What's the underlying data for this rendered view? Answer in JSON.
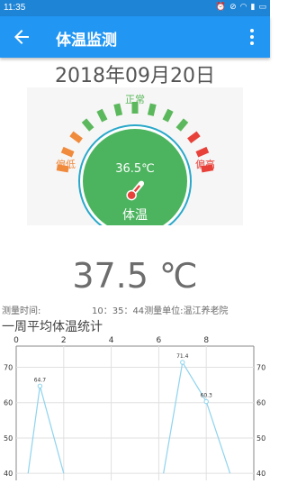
{
  "status": {
    "time": "11:35"
  },
  "appbar": {
    "title": "体温监测",
    "back_icon": "arrow-back-icon",
    "more_icon": "more-vert-icon"
  },
  "date": "2018年09月20日",
  "gauge": {
    "label_normal": "正常",
    "label_low": "偏低",
    "label_high": "偏高",
    "center_temp": "36.5℃",
    "center_label": "体温",
    "icon": "thermometer-icon",
    "colors": {
      "low": "#f08a3c",
      "normal": "#5cb85c",
      "high": "#e8413a",
      "center": "#4cb45f",
      "ring": "#2aa8c9"
    }
  },
  "current_temp": "37.5 ℃",
  "measure": {
    "time_label": "测量时间:",
    "time_value": "10：35：44",
    "unit_label": "测量单位:",
    "unit_value": "温江养老院"
  },
  "chart_title": "一周平均体温统计",
  "chart_data": {
    "type": "line",
    "x": [
      0,
      1,
      2,
      3,
      4,
      5,
      6,
      7,
      8,
      9
    ],
    "series": [
      {
        "values": [
          null,
          64.7,
          40,
          null,
          null,
          null,
          null,
          71.4,
          60.3,
          40
        ]
      }
    ],
    "point_labels": [
      "",
      "64.7",
      "",
      "",
      "",
      "",
      "",
      "71.4",
      "60.3",
      ""
    ],
    "xticks": [
      "0",
      "2",
      "4",
      "6",
      "8"
    ],
    "xtick_values": [
      0,
      2,
      4,
      6,
      8
    ],
    "yticks": [
      "70",
      "60",
      "50",
      "40"
    ],
    "ytick_values": [
      70,
      60,
      50,
      40
    ],
    "xlim": [
      0,
      10
    ],
    "ylim": [
      38,
      76
    ],
    "line_color": "#8fd3ee",
    "grid": true
  }
}
